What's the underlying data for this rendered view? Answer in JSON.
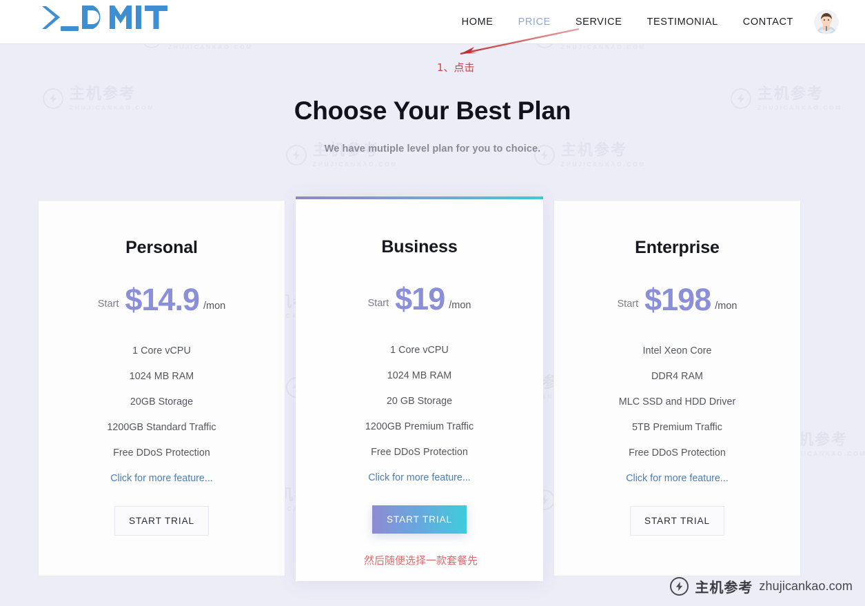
{
  "header": {
    "brand": "DMIT",
    "nav": [
      {
        "label": "HOME",
        "active": false
      },
      {
        "label": "PRICE",
        "active": true
      },
      {
        "label": "SERVICE",
        "active": false
      },
      {
        "label": "TESTIMONIAL",
        "active": false
      },
      {
        "label": "CONTACT",
        "active": false
      }
    ],
    "avatar_icon": "user-avatar-icon"
  },
  "annotations": {
    "step1": "1、点击",
    "step2": "然后随便选择一款套餐先",
    "arrow_icon": "red-arrow-icon",
    "arrow_color": "#c83c3c"
  },
  "hero": {
    "title": "Choose Your Best Plan",
    "subtitle": "We have mutiple level plan for you to choice."
  },
  "plans": [
    {
      "name": "Personal",
      "start_label": "Start",
      "price": "$14.9",
      "period": "/mon",
      "features": [
        "1 Core vCPU",
        "1024 MB RAM",
        "20GB Storage",
        "1200GB Standard Traffic",
        "Free DDoS Protection"
      ],
      "more_link": "Click for more feature...",
      "cta": "START TRIAL",
      "featured": false
    },
    {
      "name": "Business",
      "start_label": "Start",
      "price": "$19",
      "period": "/mon",
      "features": [
        "1 Core vCPU",
        "1024 MB RAM",
        "20 GB Storage",
        "1200GB Premium Traffic",
        "Free DDoS Protection"
      ],
      "more_link": "Click for more feature...",
      "cta": "START TRIAL",
      "featured": true
    },
    {
      "name": "Enterprise",
      "start_label": "Start",
      "price": "$198",
      "period": "/mon",
      "features": [
        "Intel Xeon Core",
        "DDR4 RAM",
        "MLC SSD and HDD Driver",
        "5TB Premium Traffic",
        "Free DDoS Protection"
      ],
      "more_link": "Click for more feature...",
      "cta": "START TRIAL",
      "featured": false
    }
  ],
  "watermark": {
    "cn": "主机参考",
    "en": "ZHUJICANKAO.COM",
    "logo_icon": "lightning-circle-icon"
  },
  "badge": {
    "cn": "主机参考",
    "url": "zhujicankao.com",
    "logo_icon": "lightning-circle-icon"
  },
  "colors": {
    "page_bg": "#ecedf7",
    "accent_price": "#8b8fd8",
    "accent_link": "#4a7fb5",
    "nav_active": "#8aa8d8",
    "gradient_start": "#8e8bd2",
    "gradient_end": "#3fcbdc",
    "annotation_red": "#d94040"
  }
}
